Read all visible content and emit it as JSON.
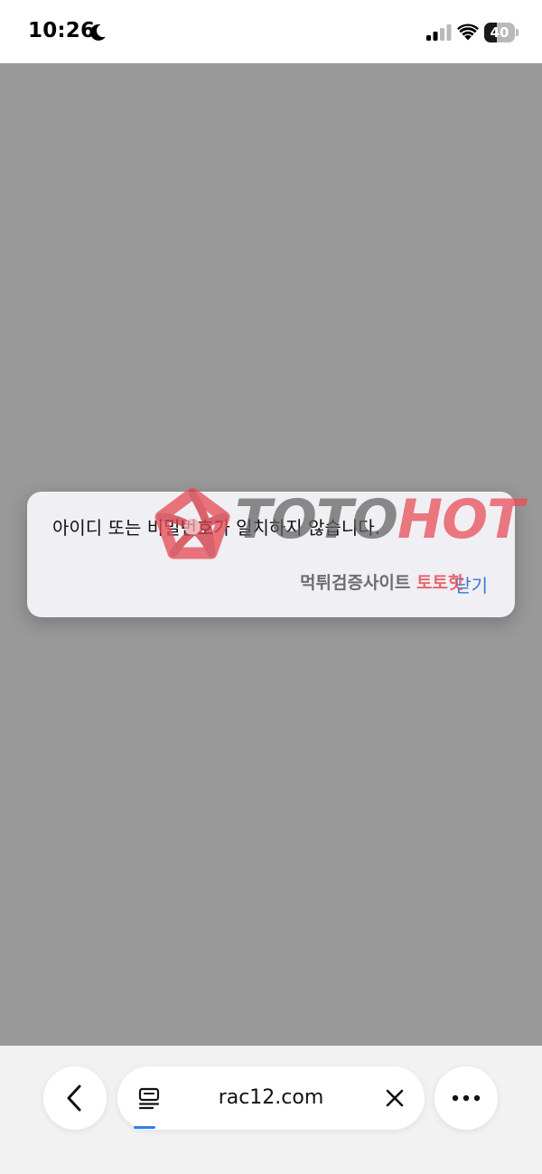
{
  "status_bar": {
    "time": "10:26",
    "battery_level": "40",
    "battery_fraction": 0.4,
    "icons": [
      "moon-icon",
      "cellular-signal-icon",
      "wifi-icon",
      "battery-icon"
    ]
  },
  "alert": {
    "message": "아이디 또는 비밀번호가 일치하지 않습니다.",
    "close_label": "닫기",
    "accent_color": "#3478d9"
  },
  "watermark": {
    "brand_part1": "TOTO",
    "brand_part2": "HOT",
    "tagline_part1": "먹튀검증사이트",
    "tagline_part2": "토토핫",
    "brand_color": "#e84e58"
  },
  "toolbar": {
    "url": "rac12.com",
    "page_load_progress": 0.08,
    "icons": [
      "back-chevron-icon",
      "reader-mode-icon",
      "clear-icon",
      "more-icon"
    ]
  }
}
